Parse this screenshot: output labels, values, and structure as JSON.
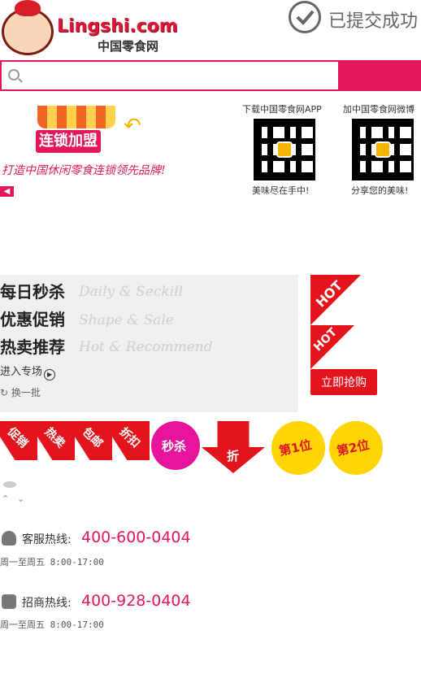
{
  "header": {
    "logo_text": "Lingshi.com",
    "logo_sub": "中国零食网",
    "submit_status": "已提交成功"
  },
  "search": {
    "placeholder": "",
    "value": ""
  },
  "franchise": {
    "label": "连锁加盟",
    "slogan": "打造中国休闲零食连锁领先品牌!"
  },
  "qr": [
    {
      "title": "下载中国零食网APP",
      "caption": "美味尽在手中!"
    },
    {
      "title": "加中国零食网微博",
      "caption": "分享您的美味!"
    }
  ],
  "promo": {
    "lines": [
      {
        "cn": "每日秒杀",
        "en": "Daily & Seckill"
      },
      {
        "cn": "优惠促销",
        "en": "Shape & Sale"
      },
      {
        "cn": "热卖推荐",
        "en": "Hot & Recommend"
      }
    ],
    "enter_label": "进入专场",
    "refresh_label": "换一批",
    "hot_label": "HOT",
    "grab_label": "立即抢购"
  },
  "tags": [
    "促销",
    "热卖",
    "包邮",
    "折扣"
  ],
  "bursts": [
    {
      "text": "秒杀",
      "color": "#e8149b",
      "text_color": "#ffffff"
    },
    {
      "text": "折",
      "color": "#e3141c",
      "text_color": "#ffffff"
    },
    {
      "text": "第1位",
      "color": "#ffd400",
      "text_color": "#e3141c"
    },
    {
      "text": "第2位",
      "color": "#ffd400",
      "text_color": "#e3141c"
    }
  ],
  "hotlines": [
    {
      "label": "客服热线:",
      "number": "400-600-0404",
      "hours": "周一至周五 8:00-17:00",
      "icon": "headset-icon"
    },
    {
      "label": "招商热线:",
      "number": "400-928-0404",
      "hours": "周一至周五 8:00-17:00",
      "icon": "store-icon"
    }
  ],
  "colors": {
    "accent": "#e3175a",
    "hot": "#e3141c"
  }
}
